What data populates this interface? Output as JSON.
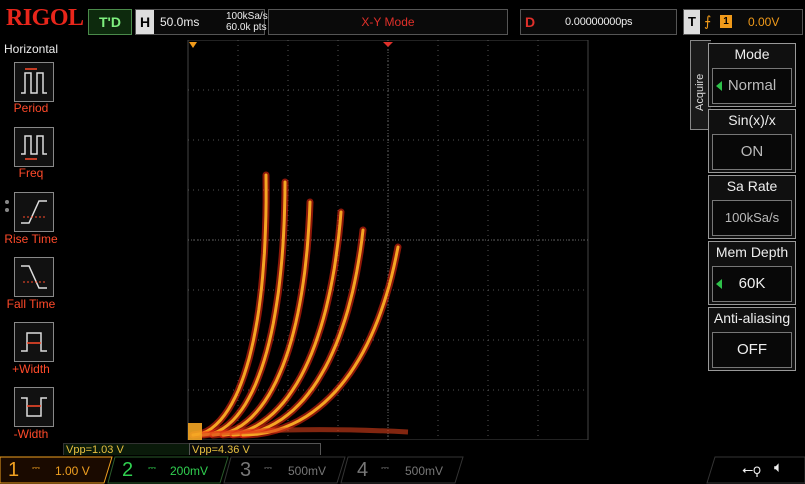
{
  "brand": "RIGOL",
  "status": "T'D",
  "horizontal": {
    "label": "H",
    "timebase": "50.0ms",
    "sample_rate": "100kSa/s",
    "points": "60.0k pts"
  },
  "mode_display": "X-Y Mode",
  "delay": {
    "label": "D",
    "value": "0.00000000ps"
  },
  "trigger": {
    "label": "T",
    "edge_icon": "rising-edge-icon",
    "source": "1",
    "level": "0.00V"
  },
  "left_menu": {
    "title": "Horizontal",
    "items": [
      {
        "label": "Period",
        "icon": "period-icon"
      },
      {
        "label": "Freq",
        "icon": "frequency-icon"
      },
      {
        "label": "Rise Time",
        "icon": "rise-time-icon"
      },
      {
        "label": "Fall Time",
        "icon": "fall-time-icon"
      },
      {
        "label": "+Width",
        "icon": "positive-width-icon"
      },
      {
        "label": "-Width",
        "icon": "negative-width-icon"
      }
    ]
  },
  "right_menu": {
    "tab": "Acquire",
    "groups": [
      {
        "title": "Mode",
        "value": "Normal",
        "has_arrow": true
      },
      {
        "title": "Sin(x)/x",
        "value": "ON",
        "has_arrow": false
      },
      {
        "title": "Sa Rate",
        "value": "100kSa/s",
        "has_arrow": false
      },
      {
        "title": "Mem Depth",
        "value": "60K",
        "has_arrow": true
      },
      {
        "title": "Anti-aliasing",
        "value": "OFF",
        "has_arrow": false
      }
    ]
  },
  "measurements": {
    "vpp1": "Vpp=1.03 V",
    "vpp2": "Vpp=4.36 V"
  },
  "channels": [
    {
      "num": "1",
      "scale": "1.00 V",
      "color": "#f0a020",
      "active": true
    },
    {
      "num": "2",
      "scale": "200mV",
      "color": "#30d050",
      "active": false
    },
    {
      "num": "3",
      "scale": "500mV",
      "color": "#777777",
      "active": false
    },
    {
      "num": "4",
      "scale": "500mV",
      "color": "#777777",
      "active": false
    }
  ],
  "colors": {
    "trace_hot": "#ff2a10",
    "trace_warm": "#f5a623",
    "trace_cool": "#3d7a2a",
    "menu_label": "#ff4a2a"
  },
  "usb_icon": "usb-icon",
  "speaker_icon": "speaker-icon"
}
